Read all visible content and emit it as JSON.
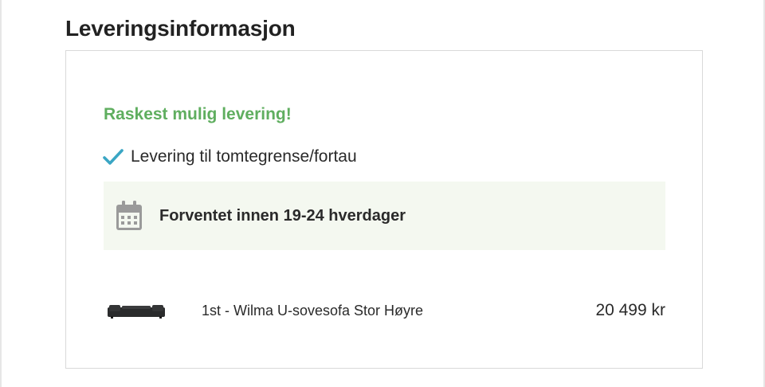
{
  "section": {
    "title": "Leveringsinformasjon"
  },
  "delivery": {
    "headline": "Raskest mulig levering!",
    "headline_color": "#5fae5f",
    "features": [
      {
        "icon": "check-icon",
        "label": "Levering til tomtegrense/fortau"
      }
    ],
    "estimate": {
      "icon": "calendar-icon",
      "label": "Forventet innen 19-24 hverdager",
      "background": "#f4f8f0"
    }
  },
  "products": [
    {
      "thumbnail": "sofa-thumbnail",
      "name": "1st - Wilma U-sovesofa Stor Høyre",
      "price": "20 499 kr"
    }
  ],
  "colors": {
    "accent_check": "#3aa6c4",
    "success_text": "#5fae5f"
  }
}
